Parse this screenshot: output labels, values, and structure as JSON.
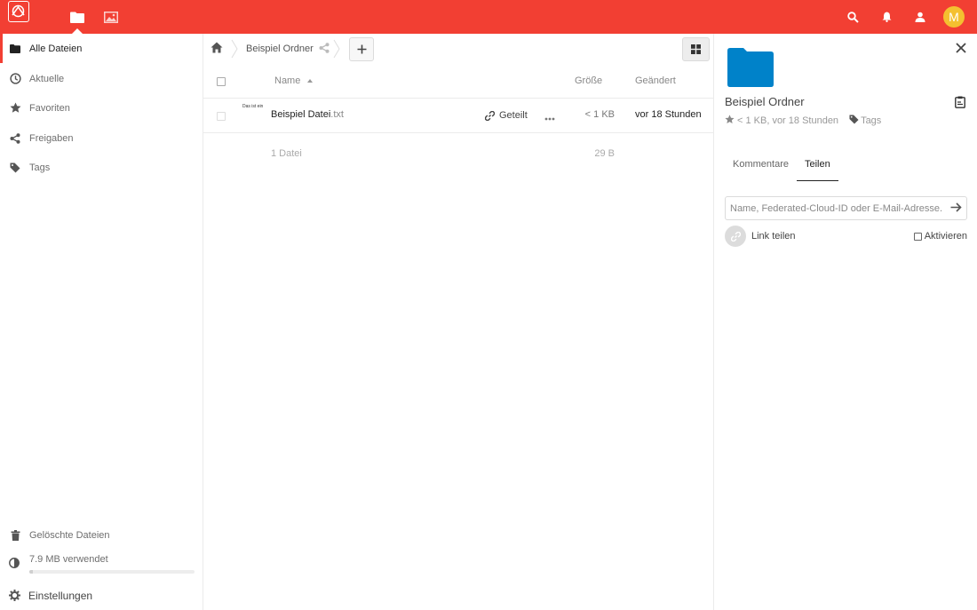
{
  "header": {
    "apps": [
      {
        "name": "files",
        "icon": "folder-icon",
        "active": true
      },
      {
        "name": "gallery",
        "icon": "image-icon",
        "active": false
      }
    ],
    "actions": [
      "search-icon",
      "bell-icon",
      "contacts-icon"
    ],
    "avatar_letter": "M",
    "colors": {
      "brand": "#f23f33",
      "avatar": "#f4c030"
    }
  },
  "sidebar": {
    "items": [
      {
        "label": "Alle Dateien",
        "icon": "folder-icon",
        "active": true
      },
      {
        "label": "Aktuelle",
        "icon": "clock-icon"
      },
      {
        "label": "Favoriten",
        "icon": "star-icon"
      },
      {
        "label": "Freigaben",
        "icon": "share-icon"
      },
      {
        "label": "Tags",
        "icon": "tag-icon"
      }
    ],
    "trash_label": "Gelöschte Dateien",
    "quota_text": "7.9 MB verwendet",
    "quota_fraction": 0.02,
    "settings_label": "Einstellungen"
  },
  "breadcrumb": {
    "folder": "Beispiel Ordner"
  },
  "table": {
    "headers": {
      "name": "Name",
      "size": "Größe",
      "modified": "Geändert"
    },
    "rows": [
      {
        "thumb_text": "Das ist ein",
        "name": "Beispiel Datei",
        "ext": ".txt",
        "shared_label": "Geteilt",
        "size": "< 1 KB",
        "modified": "vor 18 Stunden"
      }
    ],
    "summary_count": "1 Datei",
    "summary_size": "29 B"
  },
  "details": {
    "title": "Beispiel Ordner",
    "meta": "< 1 KB, vor 18 Stunden",
    "tags_label": "Tags",
    "tabs": [
      "Kommentare",
      "Teilen"
    ],
    "active_tab": "Teilen",
    "share_placeholder": "Name, Federated-Cloud-ID oder E-Mail-Adresse...",
    "link_label": "Link teilen",
    "activate_label": "Aktivieren",
    "folder_color": "#0082c9"
  }
}
